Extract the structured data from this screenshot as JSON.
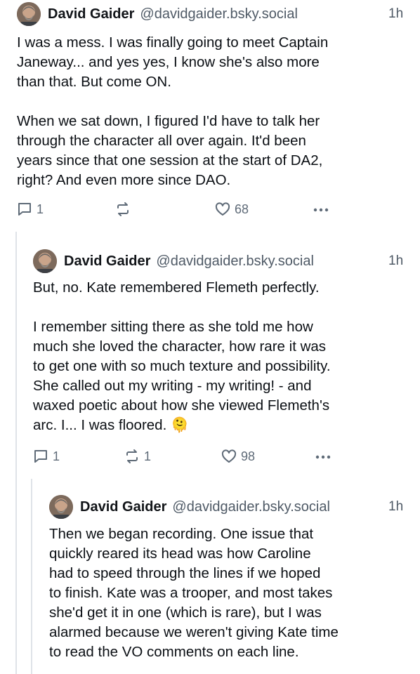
{
  "posts": [
    {
      "author": "David Gaider",
      "handle": "@davidgaider.bsky.social",
      "time": "1h",
      "paragraphs": [
        "I was a mess. I was finally going to meet Captain\nJaneway... and yes yes, I know she's also more\nthan that. But come ON.",
        "When we sat down, I figured I'd have to talk her\nthrough the character all over again. It'd been\nyears since that one session at the start of DA2,\nright? And even more since DAO."
      ],
      "replies": "1",
      "reposts": "",
      "likes": "68"
    },
    {
      "author": "David Gaider",
      "handle": "@davidgaider.bsky.social",
      "time": "1h",
      "paragraphs": [
        "But, no. Kate remembered Flemeth perfectly.",
        "I remember sitting there as she told me how\nmuch she loved the character, how rare it was\nto get one with so much texture and possibility.\nShe called out my writing - my writing! - and\nwaxed poetic about how she viewed Flemeth's\narc. I... I was floored. 🫠"
      ],
      "replies": "1",
      "reposts": "1",
      "likes": "98"
    },
    {
      "author": "David Gaider",
      "handle": "@davidgaider.bsky.social",
      "time": "1h",
      "paragraphs": [
        "Then we began recording. One issue that\nquickly reared its head was how Caroline\nhad to speed through the lines if we hoped\nto finish. Kate was a trooper, and most takes\nshe'd get it in one (which is rare), but I was\nalarmed because we weren't giving Kate time\nto read the VO comments on each line."
      ]
    }
  ],
  "icons": {
    "reply": "speech-bubble-icon",
    "repost": "repost-arrows-icon",
    "like": "heart-outline-icon",
    "more": "ellipsis-icon"
  },
  "colors": {
    "text": "#0b0f14",
    "muted": "#5f6b78",
    "thread_line": "#dfe3e8"
  }
}
